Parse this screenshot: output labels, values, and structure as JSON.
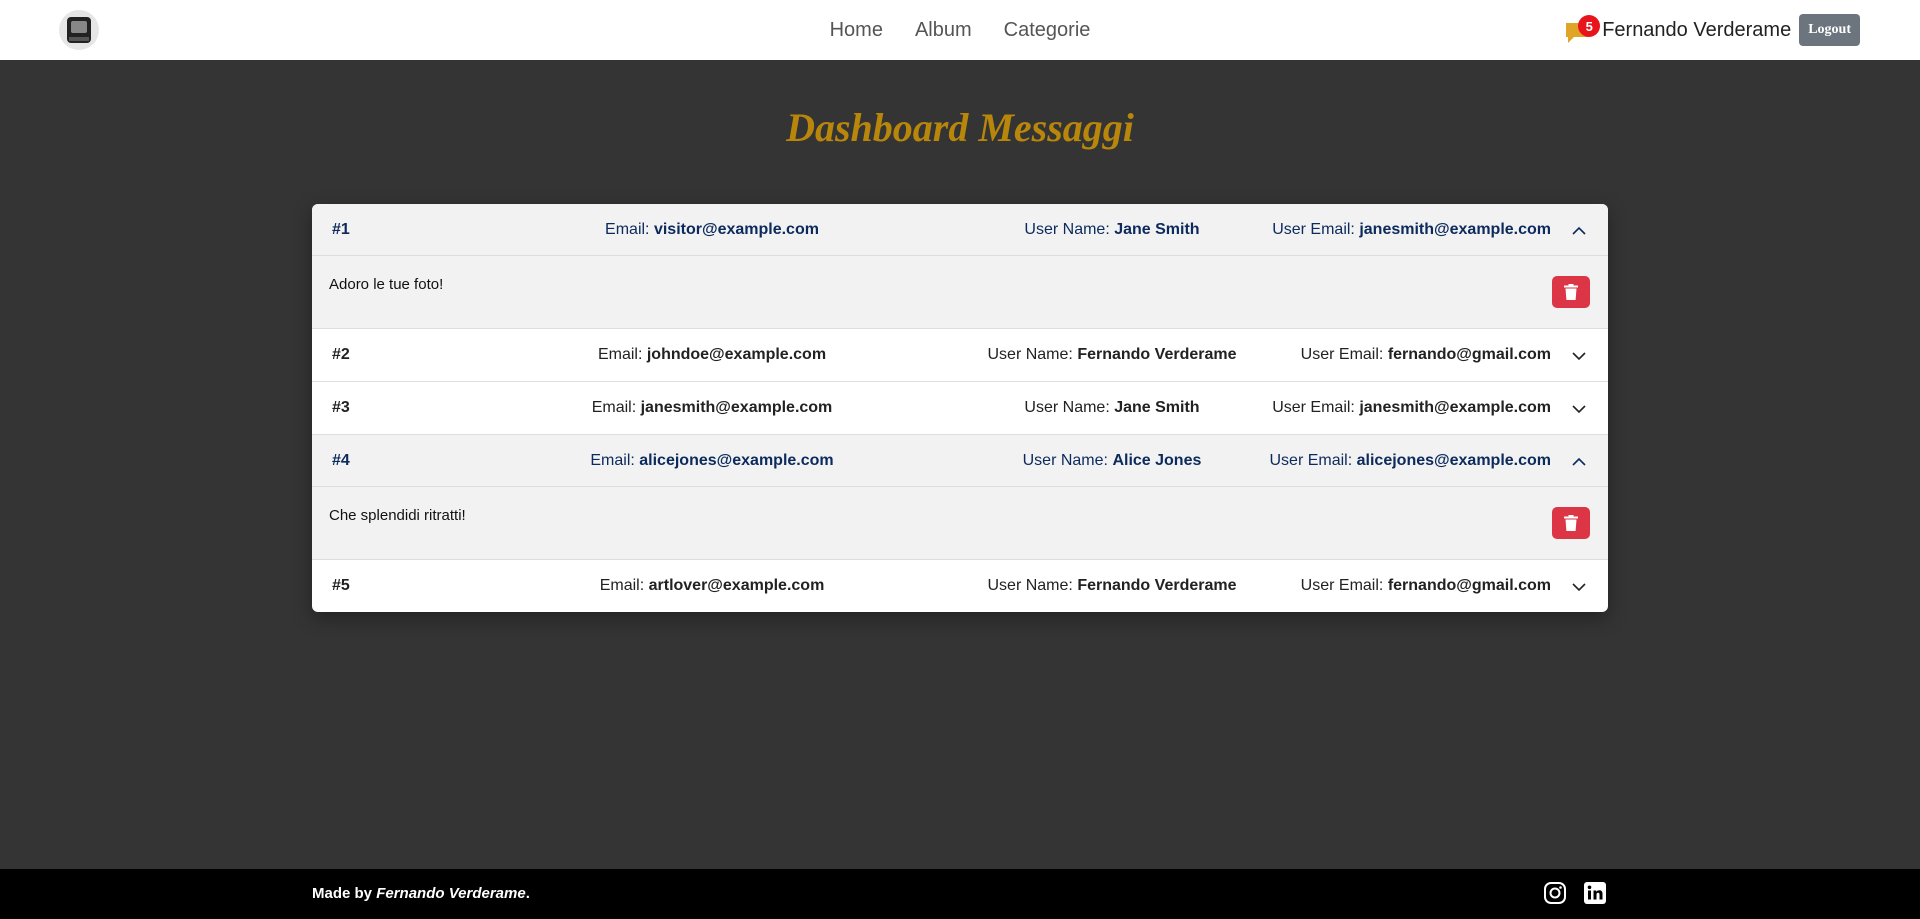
{
  "nav": {
    "links": [
      "Home",
      "Album",
      "Categorie"
    ],
    "notification_count": "5",
    "user_name": "Fernando Verderame",
    "logout_label": "Logout"
  },
  "page": {
    "title": "Dashboard Messaggi"
  },
  "labels": {
    "email": "Email:",
    "user_name": "User Name:",
    "user_email": "User Email:"
  },
  "messages": [
    {
      "num": "#1",
      "email": "visitor@example.com",
      "user_name": "Jane Smith",
      "user_email": "janesmith@example.com",
      "expanded": true,
      "text": "Adoro le tue foto!"
    },
    {
      "num": "#2",
      "email": "johndoe@example.com",
      "user_name": "Fernando Verderame",
      "user_email": "fernando@gmail.com",
      "expanded": false,
      "text": ""
    },
    {
      "num": "#3",
      "email": "janesmith@example.com",
      "user_name": "Jane Smith",
      "user_email": "janesmith@example.com",
      "expanded": false,
      "text": ""
    },
    {
      "num": "#4",
      "email": "alicejones@example.com",
      "user_name": "Alice Jones",
      "user_email": "alicejones@example.com",
      "expanded": true,
      "text": "Che splendidi ritratti!"
    },
    {
      "num": "#5",
      "email": "artlover@example.com",
      "user_name": "Fernando Verderame",
      "user_email": "fernando@gmail.com",
      "expanded": false,
      "text": ""
    }
  ],
  "footer": {
    "made_by": "Made by",
    "author": "Fernando Verderame",
    "period": "."
  },
  "colors": {
    "title": "#b8860b",
    "background": "#343434",
    "delete": "#dc3545",
    "badge": "#e8141b",
    "message_icon": "#e0a526"
  }
}
